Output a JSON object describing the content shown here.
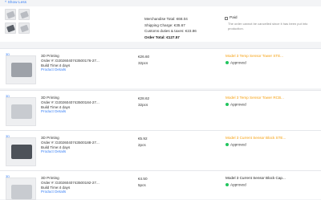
{
  "show_less": "^ Show Less",
  "summary": {
    "merchandise": "Merchandise Total: €68.04",
    "shipping": "Shipping Charge: €35.67",
    "customs": "Customs duties & taxes: €23.86",
    "order_total": "Order Total: €127.57",
    "paid_label": "Paid",
    "paid_note": "The order cannot be cancelled since it has been put into production."
  },
  "items": [
    {
      "badge": "3D",
      "title": "3D Printing",
      "order": "Order #: D202604074350017​6-27...",
      "build": "Build Time:4 days",
      "details": "Product Details",
      "price": "€26.60",
      "qty": "32pcs",
      "model": "Model 3 Temp Sensor Tower STE...",
      "status": "Approved",
      "thumb_icon": "sensor-tower-part"
    },
    {
      "badge": "3D",
      "title": "3D Printing",
      "order": "Order #: D202604074350018​4-27...",
      "build": "Build Time:4 days",
      "details": "Product Details",
      "price": "€28.62",
      "qty": "32pcs",
      "model": "Model 3 Temp Sensor Tower RCB...",
      "status": "Approved",
      "thumb_icon": "sensor-tower-part"
    },
    {
      "badge": "3D",
      "title": "3D Printing",
      "order": "Order #: D202604074350018​8-27...",
      "build": "Build Time:4 days",
      "details": "Product Details",
      "price": "€5.92",
      "qty": "2pcs",
      "model": "Model 3 Current Sensor Block STE...",
      "status": "Approved",
      "thumb_icon": "sensor-block-part"
    },
    {
      "badge": "3D",
      "title": "3D Printing",
      "order": "Order #: D202604074350019​2-27...",
      "build": "Build Time:4 days",
      "details": "Product Details",
      "price": "€4.50",
      "qty": "5pcs",
      "model": "Model 3 Current Sensor Block Cap...",
      "status": "Approved",
      "thumb_icon": "sensor-cap-part"
    }
  ]
}
